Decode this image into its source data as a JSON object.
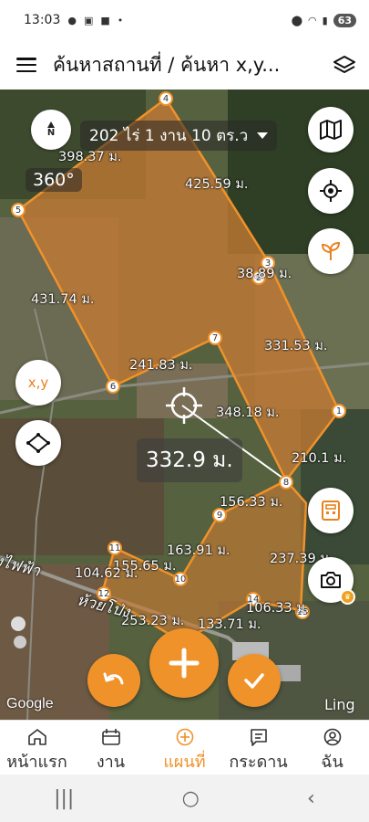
{
  "status_bar": {
    "time": "13:03",
    "battery": "63"
  },
  "app_bar": {
    "title": "ค้นหาสถานที่ / ค้นหา x,y..."
  },
  "map": {
    "area_label": "202 ไร่ 1 งาน 10 ตร.ว",
    "heading": "360°",
    "compass_letter": "N",
    "measure_value": "332.9 ม.",
    "xy_button": "x,y",
    "google_logo": "Google",
    "attribution": "Ling",
    "road_label": "งไฟฟ้า",
    "road_label2": "ห้วยโป่ง",
    "vertices": [
      "2",
      "3",
      "4",
      "5",
      "6",
      "7",
      "8",
      "9",
      "10",
      "11",
      "12",
      "14",
      "15",
      "1"
    ],
    "distances": [
      "398.37 ม.",
      "425.59 ม.",
      "38.89 ม.",
      "431.74 ม.",
      "331.53 ม.",
      "241.83 ม.",
      "348.18 ม.",
      "210.1 ม.",
      "156.33 ม.",
      "163.91 ม.",
      "155.65 ม.",
      "104.62 ม.",
      "237.39 ม.",
      "253.23 ม.",
      "133.71 ม.",
      "106.33 ม."
    ]
  },
  "bottom_nav": [
    {
      "label": "หน้าแรก",
      "icon": "home-icon"
    },
    {
      "label": "งาน",
      "icon": "calendar-icon"
    },
    {
      "label": "แผนที่",
      "icon": "add-circle-icon",
      "active": true
    },
    {
      "label": "กระดาน",
      "icon": "board-icon"
    },
    {
      "label": "ฉัน",
      "icon": "profile-icon"
    }
  ],
  "colors": {
    "accent": "#f0922a",
    "plot_fill": "#c47a33"
  }
}
